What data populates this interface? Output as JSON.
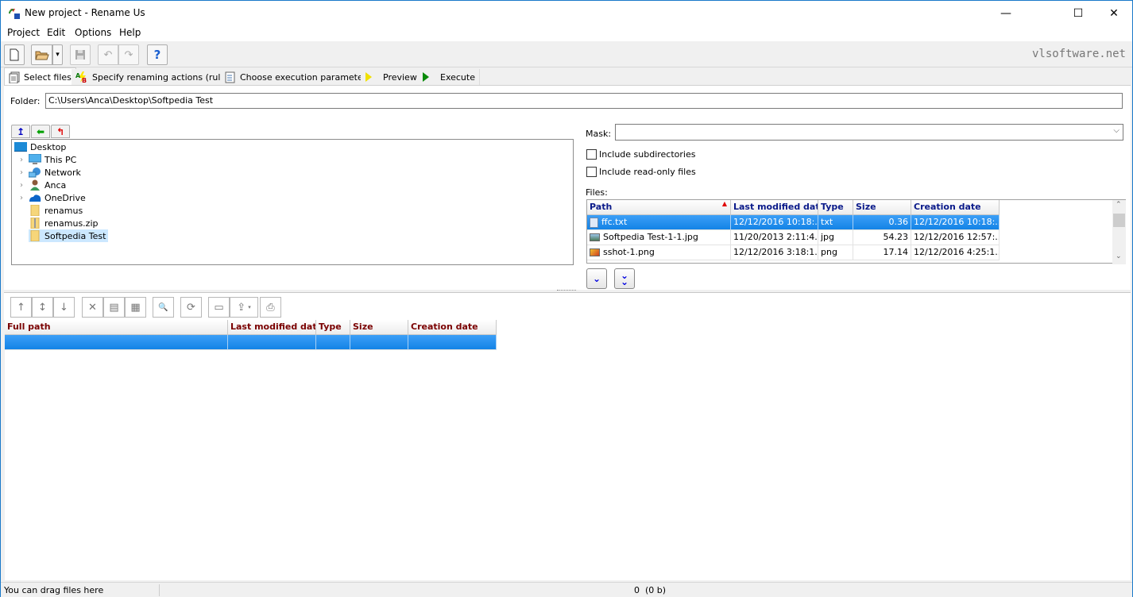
{
  "window": {
    "title": "New project - Rename Us",
    "controls": {
      "minimize": "—",
      "maximize": "☐",
      "close": "✕"
    }
  },
  "menu": [
    "Project",
    "Edit",
    "Options",
    "Help"
  ],
  "toolbar": {
    "buttons": [
      {
        "name": "new-icon",
        "glyph": "🗋"
      },
      {
        "name": "open-icon",
        "glyph": "📂"
      },
      {
        "name": "dropdown-icon",
        "glyph": "▾"
      },
      {
        "name": "save-icon",
        "glyph": "💾"
      },
      {
        "name": "undo-icon",
        "glyph": "↶"
      },
      {
        "name": "redo-icon",
        "glyph": "↷"
      },
      {
        "name": "help-icon",
        "glyph": "?"
      }
    ],
    "brand": "vlsoftware.net"
  },
  "tabs": [
    {
      "label": "Select files",
      "icon": "pages-icon",
      "active": true
    },
    {
      "label": "Specify renaming actions (rules)",
      "icon": "ab-icon"
    },
    {
      "label": "Choose execution parameters",
      "icon": "checklist-icon"
    },
    {
      "label": "Preview",
      "icon": "play-yellow-icon"
    },
    {
      "label": "Execute",
      "icon": "play-green-icon"
    }
  ],
  "folder": {
    "label": "Folder:",
    "value": "C:\\Users\\Anca\\Desktop\\Softpedia Test"
  },
  "nav_buttons": [
    {
      "glyph": "↥",
      "color": "#0000c0"
    },
    {
      "glyph": "⬅",
      "color": "#00a000"
    },
    {
      "glyph": "↰",
      "color": "#e00000"
    }
  ],
  "tree": [
    {
      "label": "Desktop",
      "icon": "desktop-icon",
      "level": 0,
      "expandable": false
    },
    {
      "label": "This PC",
      "icon": "computer-icon",
      "level": 1,
      "expandable": true
    },
    {
      "label": "Network",
      "icon": "network-icon",
      "level": 1,
      "expandable": true
    },
    {
      "label": "Anca",
      "icon": "user-icon",
      "level": 1,
      "expandable": true
    },
    {
      "label": "OneDrive",
      "icon": "cloud-icon",
      "level": 1,
      "expandable": true
    },
    {
      "label": "renamus",
      "icon": "folder-icon",
      "level": 1,
      "expandable": false
    },
    {
      "label": "renamus.zip",
      "icon": "zip-folder-icon",
      "level": 1,
      "expandable": false
    },
    {
      "label": "Softpedia Test",
      "icon": "folder-icon",
      "level": 1,
      "expandable": false,
      "selected": true
    }
  ],
  "mask": {
    "label": "Mask:",
    "value": ""
  },
  "options": [
    {
      "label": "Include subdirectories",
      "checked": false
    },
    {
      "label": "Include read-only files",
      "checked": false
    }
  ],
  "files": {
    "label": "Files:",
    "columns": [
      "Path",
      "Last modified date",
      "Type",
      "Size",
      "Creation date"
    ],
    "sort_indicator": "▲",
    "rows": [
      {
        "path": "ffc.txt",
        "icon": "text-file-icon",
        "modified": "12/12/2016 10:18:...",
        "type": "txt",
        "size": "0.36",
        "created": "12/12/2016 10:18:...",
        "selected": true
      },
      {
        "path": "Softpedia Test-1-1.jpg",
        "icon": "image-file-icon",
        "modified": "11/20/2013 2:11:4...",
        "type": "jpg",
        "size": "54.23",
        "created": "12/12/2016 12:57:..."
      },
      {
        "path": "sshot-1.png",
        "icon": "png-file-icon",
        "modified": "12/12/2016 3:18:1...",
        "type": "png",
        "size": "17.14",
        "created": "12/12/2016 4:25:1..."
      }
    ],
    "add_buttons": [
      {
        "name": "add-selected-button",
        "glyph": "⌄"
      },
      {
        "name": "add-all-button",
        "glyph": "⏬"
      }
    ]
  },
  "bottom_toolbar": [
    {
      "name": "move-up-icon",
      "glyph": "↑"
    },
    {
      "name": "move-updown-icon",
      "glyph": "↕"
    },
    {
      "name": "move-down-icon",
      "glyph": "↓"
    },
    {
      "name": "remove-icon",
      "glyph": "✕"
    },
    {
      "name": "remove-selected-icon",
      "glyph": "▤"
    },
    {
      "name": "remove-all-icon",
      "glyph": "▦"
    },
    {
      "name": "find-icon",
      "glyph": "🔍"
    },
    {
      "name": "refresh-icon",
      "glyph": "⟳"
    },
    {
      "name": "columns-icon",
      "glyph": "▭"
    },
    {
      "name": "export-icon",
      "glyph": "⇪"
    },
    {
      "name": "print-icon",
      "glyph": "⎙"
    }
  ],
  "selection_grid": {
    "columns": [
      "Full path",
      "Last modified date",
      "Type",
      "Size",
      "Creation date"
    ]
  },
  "status": {
    "left": "You can drag files here",
    "right": "0  (0 b)"
  }
}
